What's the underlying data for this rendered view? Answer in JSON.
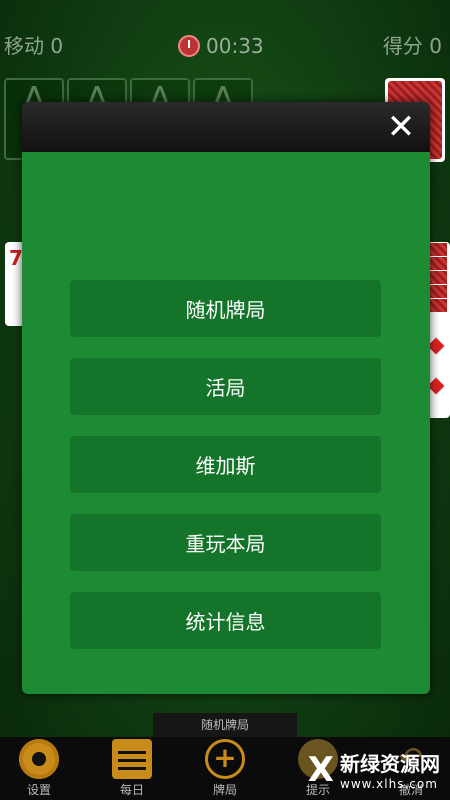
{
  "status": {
    "moves": "移动 0",
    "timer": "00:33",
    "score": "得分 0"
  },
  "board": {
    "foundation_symbol": "A",
    "left_card_rank": "7"
  },
  "modal": {
    "close_label": "✕",
    "buttons": [
      {
        "label": "随机牌局"
      },
      {
        "label": "活局"
      },
      {
        "label": "维加斯"
      },
      {
        "label": "重玩本局"
      },
      {
        "label": "统计信息"
      }
    ]
  },
  "bottom": {
    "current_mode": "随机牌局",
    "tools": [
      {
        "label": "设置",
        "icon": "gear-icon"
      },
      {
        "label": "每日",
        "icon": "calendar-icon"
      },
      {
        "label": "牌局",
        "icon": "plus-icon"
      },
      {
        "label": "提示",
        "icon": "hint-icon"
      },
      {
        "label": "撤消",
        "icon": "undo-icon"
      }
    ]
  },
  "watermark": {
    "logo": "X",
    "name": "新绿资源网",
    "url": "www.xlhs.com"
  },
  "colors": {
    "modal_body": "#1c8b33",
    "menu_button": "#147429",
    "accent": "#c98b1a"
  }
}
